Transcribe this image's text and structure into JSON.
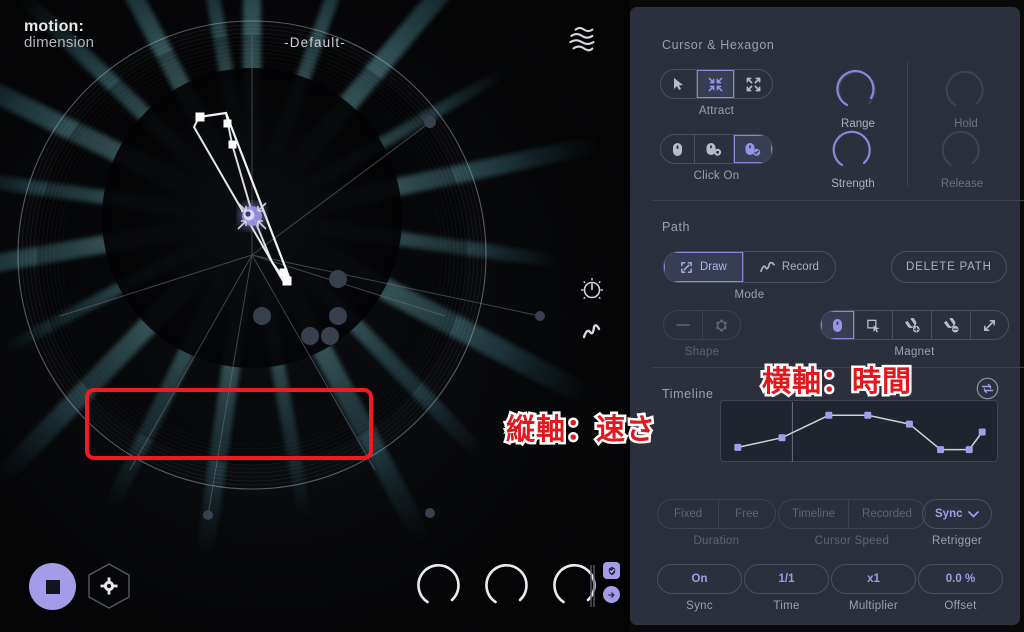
{
  "app": {
    "logo_line1": "motion:",
    "logo_line2": "dimension",
    "preset_name": "-Default-",
    "accent": "#a49ce8",
    "panel_bg": "#2b303c",
    "annotation_color": "#e4171d"
  },
  "visualizer": {
    "wave_icon": "wave-circle-icon",
    "knob_icon": "knob-icon",
    "squiggle_icon": "squiggle-record-icon",
    "stop_button": "stop-button",
    "settings_hexagon": "settings-hexagon-button",
    "bottom_knobs": [
      "knob-1",
      "knob-2",
      "knob-3"
    ],
    "badges": [
      "shield-check-icon",
      "arrow-right-icon"
    ]
  },
  "cursor_hexagon": {
    "title": "Cursor & Hexagon",
    "attract_label": "Attract",
    "attract_options": [
      {
        "icon": "pointer-icon",
        "selected": false
      },
      {
        "icon": "attract-arrows-icon",
        "selected": true
      },
      {
        "icon": "expand-arrows-icon",
        "selected": false
      }
    ],
    "click_on_label": "Click On",
    "click_on_options": [
      {
        "icon": "mouse-icon",
        "selected": false
      },
      {
        "icon": "mouse-gear-icon",
        "selected": false
      },
      {
        "icon": "mouse-check-icon",
        "selected": true
      }
    ],
    "knobs": [
      {
        "label": "Range",
        "value": 62,
        "active": true
      },
      {
        "label": "Hold",
        "value": 0,
        "active": false
      },
      {
        "label": "Strength",
        "value": 78,
        "active": true
      },
      {
        "label": "Release",
        "value": 0,
        "active": false
      }
    ]
  },
  "path": {
    "title": "Path",
    "mode_label": "Mode",
    "mode_options": [
      {
        "label": "Draw",
        "icon": "draw-icon",
        "selected": true
      },
      {
        "label": "Record",
        "icon": "record-squiggle-icon",
        "selected": false
      }
    ],
    "delete_path_label": "DELETE PATH",
    "shape_label": "Shape",
    "shape_options": [
      {
        "icon": "line-shape-icon",
        "selected": false
      },
      {
        "icon": "polygon-shape-icon",
        "selected": false
      }
    ],
    "magnet_label": "Magnet",
    "magnet_options": [
      {
        "icon": "mouse-icon",
        "selected": true
      },
      {
        "icon": "select-box-icon",
        "selected": false
      },
      {
        "icon": "magnet-add-icon",
        "selected": false
      },
      {
        "icon": "magnet-remove-icon",
        "selected": false
      },
      {
        "icon": "diagonal-expand-icon",
        "selected": false
      }
    ]
  },
  "timeline": {
    "title": "Timeline",
    "loop_icon": "loop-icon",
    "duration_label": "Duration",
    "duration_options": [
      {
        "label": "Fixed",
        "selected": false
      },
      {
        "label": "Free",
        "selected": false
      }
    ],
    "cursor_speed_label": "Cursor Speed",
    "cursor_speed_options": [
      {
        "label": "Timeline",
        "selected": false
      },
      {
        "label": "Recorded",
        "selected": false
      }
    ],
    "retrigger_label": "Retrigger",
    "retrigger_value": "Sync",
    "retrigger_caret": "chevron-down-icon",
    "params": [
      {
        "label": "Sync",
        "value": "On"
      },
      {
        "label": "Time",
        "value": "1/1"
      },
      {
        "label": "Multiplier",
        "value": "x1"
      },
      {
        "label": "Offset",
        "value": "0.0 %"
      }
    ]
  },
  "annotations": {
    "y_axis": "縦軸：速さ",
    "x_axis": "横軸：時間"
  },
  "chart_data": {
    "type": "line",
    "title": "Timeline speed envelope",
    "xlabel": "横軸：時間",
    "ylabel": "縦軸：速さ",
    "xlim": [
      0,
      100
    ],
    "ylim": [
      0,
      100
    ],
    "grid": false,
    "playhead_x": 24,
    "points": [
      {
        "x": 3,
        "y": 15
      },
      {
        "x": 20,
        "y": 37
      },
      {
        "x": 38,
        "y": 88
      },
      {
        "x": 53,
        "y": 88
      },
      {
        "x": 69,
        "y": 68
      },
      {
        "x": 81,
        "y": 10
      },
      {
        "x": 92,
        "y": 10
      },
      {
        "x": 97,
        "y": 50
      }
    ]
  }
}
